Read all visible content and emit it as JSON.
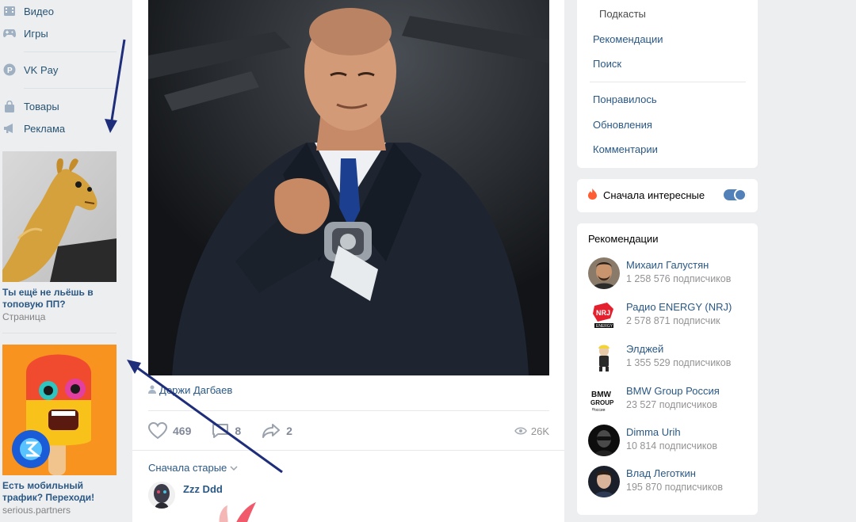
{
  "sidebar": {
    "items": [
      {
        "label": "Видео",
        "icon": "video-icon"
      },
      {
        "label": "Игры",
        "icon": "gamepad-icon"
      },
      {
        "label": "VK Pay",
        "icon": "vk-pay-icon"
      },
      {
        "label": "Товары",
        "icon": "bag-icon"
      },
      {
        "label": "Реклама",
        "icon": "megaphone-icon"
      }
    ],
    "ads": [
      {
        "title": "Ты ещё не льёшь в топовую ПП?",
        "source": "Страница"
      },
      {
        "title": "Есть мобильный трафик? Переходи!",
        "source": "serious.partners"
      }
    ]
  },
  "post": {
    "signed_by": "Доржи Дагбаев",
    "likes": "469",
    "comments": "8",
    "shares": "2",
    "views": "26K",
    "sort_label": "Сначала старые",
    "comment": {
      "author": "Zzz Ddd"
    }
  },
  "right_menu": {
    "items": [
      "Подкасты",
      "Рекомендации",
      "Поиск",
      "Понравилось",
      "Обновления",
      "Комментарии"
    ]
  },
  "toggle": {
    "label": "Сначала интересные",
    "on": true
  },
  "recommendations": {
    "title": "Рекомендации",
    "items": [
      {
        "name": "Михаил Галустян",
        "subs": "1 258 576 подписчиков"
      },
      {
        "name": "Радио ENERGY (NRJ)",
        "subs": "2 578 871 подписчик"
      },
      {
        "name": "Элджей",
        "subs": "1 355 529 подписчиков"
      },
      {
        "name": "BMW Group Россия",
        "subs": "23 527 подписчиков"
      },
      {
        "name": "Dimma Urih",
        "subs": "10 814 подписчиков"
      },
      {
        "name": "Влад Леготкин",
        "subs": "195 870 подписчиков"
      }
    ]
  },
  "colors": {
    "link": "#2a5885",
    "accent": "#5181b8",
    "bg": "#edeef0",
    "arrow": "#1f2e7a"
  }
}
